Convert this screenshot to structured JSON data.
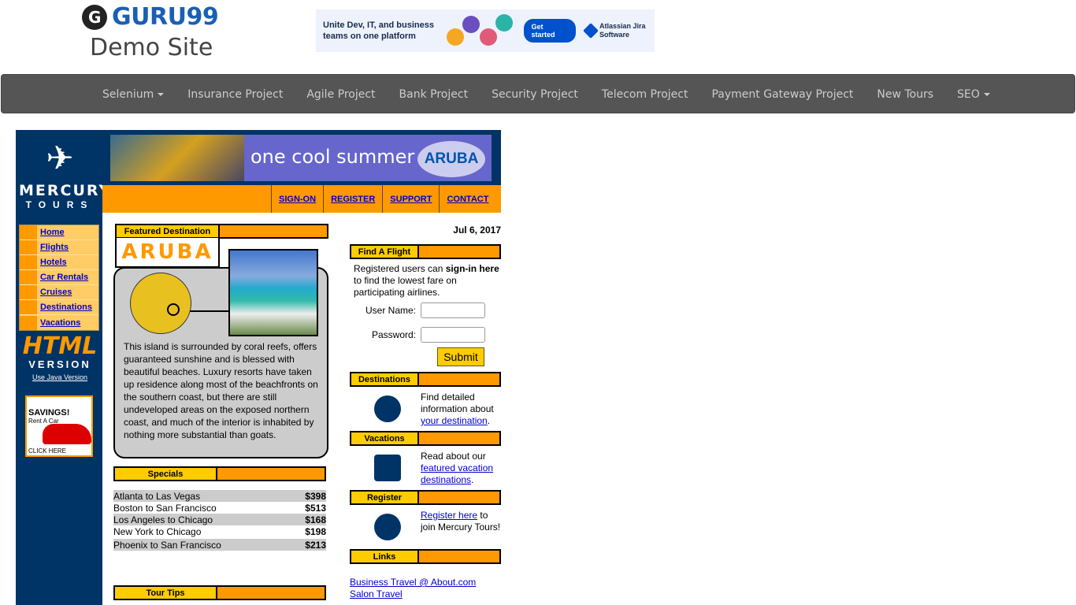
{
  "header": {
    "brand": "GURU99",
    "subtitle": "Demo Site",
    "ad": {
      "text": "Unite Dev, IT, and business teams on one platform",
      "cta": "Get started",
      "vendor": "Atlassian Jira Software"
    }
  },
  "nav": {
    "items": [
      {
        "label": "Selenium",
        "dropdown": true
      },
      {
        "label": "Insurance Project"
      },
      {
        "label": "Agile Project"
      },
      {
        "label": "Bank Project"
      },
      {
        "label": "Security Project"
      },
      {
        "label": "Telecom Project"
      },
      {
        "label": "Payment Gateway Project"
      },
      {
        "label": "New Tours"
      },
      {
        "label": "SEO",
        "dropdown": true
      }
    ]
  },
  "mercury": {
    "logo_line1": "MERCURY",
    "logo_line2": "TOURS",
    "banner_text": "one cool summer",
    "banner_logo": "ARUBA",
    "top_menu": [
      "SIGN-ON",
      "REGISTER",
      "SUPPORT",
      "CONTACT"
    ],
    "side_menu": [
      "Home",
      "Flights",
      "Hotels",
      "Car Rentals",
      "Cruises",
      "Destinations",
      "Vacations"
    ],
    "html_version": {
      "line1": "HTML",
      "line2": "VERSION",
      "link": "Use Java Version"
    },
    "savings": {
      "title": "SAVINGS!",
      "sub": "Rent A Car",
      "cta": "CLICK HERE"
    },
    "featured": {
      "header": "Featured Destination",
      "name": "ARUBA",
      "text": "This island is surrounded by coral reefs, offers guaranteed sunshine and is blessed with beautiful beaches. Luxury resorts have taken up residence along most of the beachfronts on the southern coast, but there are still undeveloped areas on the exposed northern coast, and much of the interior is inhabited by nothing more substantial than goats."
    },
    "specials": {
      "header": "Specials",
      "rows": [
        {
          "route": "Atlanta to Las Vegas",
          "price": "$398"
        },
        {
          "route": "Boston to San Francisco",
          "price": "$513"
        },
        {
          "route": "Los Angeles to Chicago",
          "price": "$168"
        },
        {
          "route": "New York to Chicago",
          "price": "$198"
        },
        {
          "route": "Phoenix to San Francisco",
          "price": "$213"
        }
      ]
    },
    "tour_tips": "Tour Tips",
    "date": "Jul 6, 2017",
    "find_flight": {
      "header": "Find A Flight",
      "text_pre": "Registered users can ",
      "text_bold": "sign-in here",
      "text_post": " to find the lowest fare on participating airlines.",
      "username_label": "User Name:",
      "password_label": "Password:",
      "submit": "Submit"
    },
    "destinations": {
      "header": "Destinations",
      "text": "Find detailed information about",
      "link": "your destination",
      "suffix": "."
    },
    "vacations": {
      "header": "Vacations",
      "text": "Read about our",
      "link": "featured vacation destinations",
      "suffix": "."
    },
    "register": {
      "header": "Register",
      "link": "Register here",
      "text": " to join Mercury Tours!"
    },
    "links": {
      "header": "Links",
      "items": [
        "Business Travel @ About.com",
        "Salon Travel"
      ]
    }
  }
}
